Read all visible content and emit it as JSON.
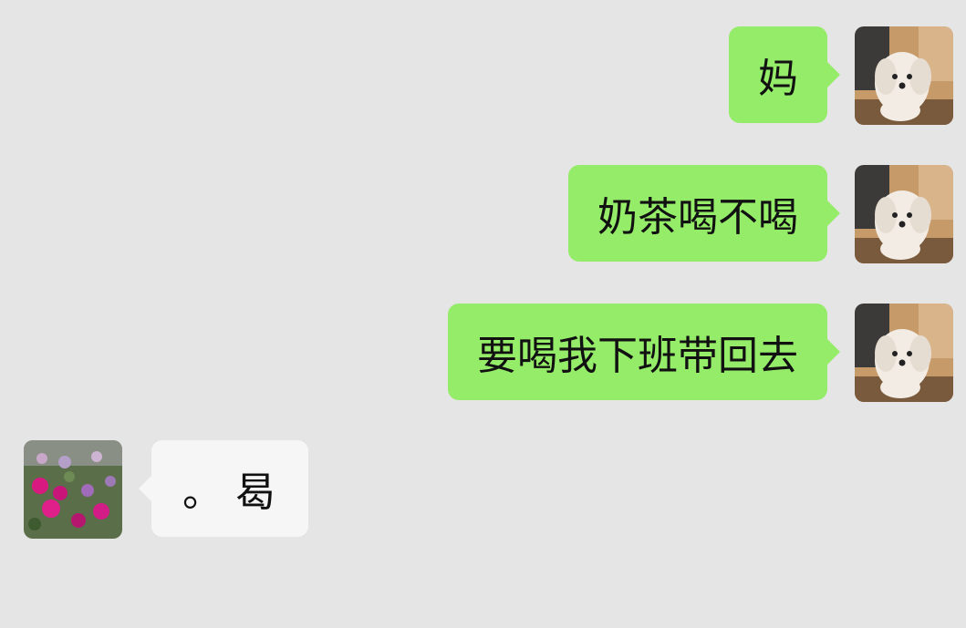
{
  "conversation": {
    "messages": [
      {
        "direction": "outgoing",
        "text": "妈",
        "avatar_icon": "dog-avatar-icon"
      },
      {
        "direction": "outgoing",
        "text": "奶茶喝不喝",
        "avatar_icon": "dog-avatar-icon"
      },
      {
        "direction": "outgoing",
        "text": "要喝我下班带回去",
        "avatar_icon": "dog-avatar-icon"
      },
      {
        "direction": "incoming",
        "text": "。 曷",
        "avatar_icon": "flower-avatar-icon"
      }
    ]
  },
  "colors": {
    "background": "#e5e5e5",
    "outgoing_bubble": "#95ec69",
    "incoming_bubble": "#f6f6f6"
  }
}
